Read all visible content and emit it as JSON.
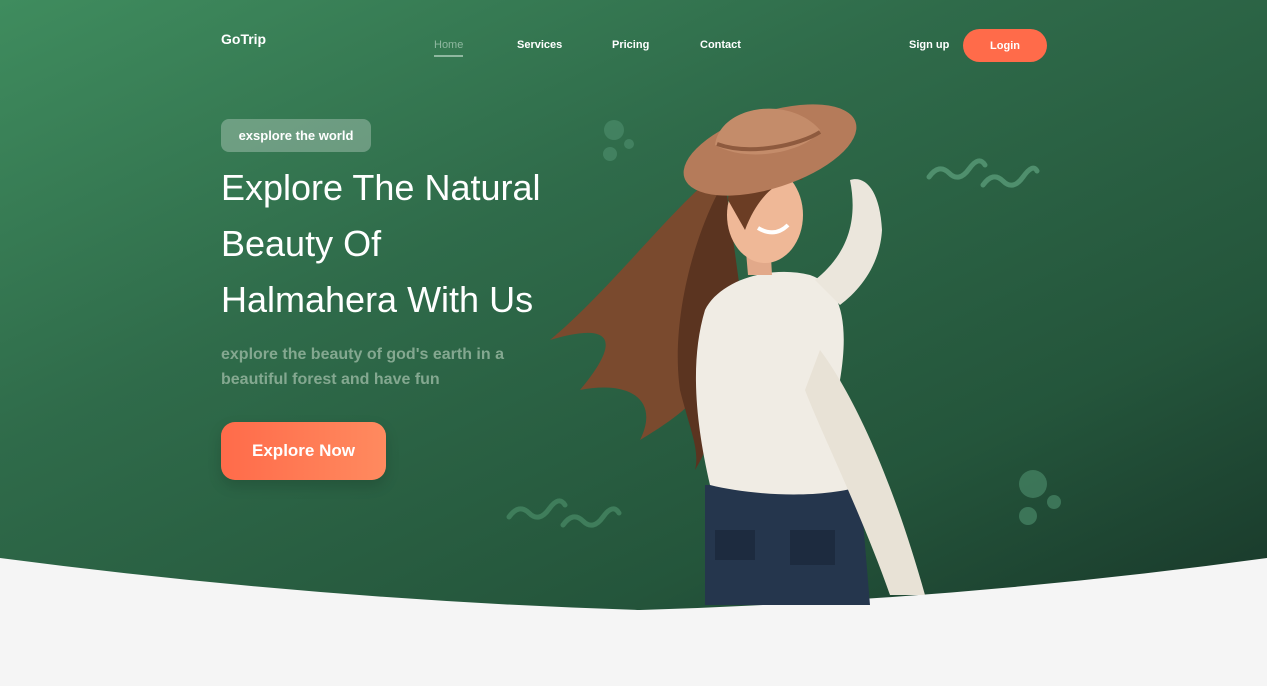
{
  "brand": {
    "logo": "GoTrip"
  },
  "nav": {
    "items": [
      {
        "label": "Home",
        "active": true
      },
      {
        "label": "Services",
        "active": false
      },
      {
        "label": "Pricing",
        "active": false
      },
      {
        "label": "Contact",
        "active": false
      }
    ],
    "signup_label": "Sign up",
    "login_label": "Login"
  },
  "hero": {
    "badge": "exsplore the world",
    "headline_lines": [
      "Explore The Natural",
      "Beauty Of",
      "Halmahera With Us"
    ],
    "subtitle": "explore the beauty of god's earth in a beautiful forest and have fun",
    "cta_label": "Explore Now"
  },
  "colors": {
    "accent": "#ff6b4a",
    "hero_green": "#2f6b4a",
    "page_background": "#f5f5f5"
  }
}
